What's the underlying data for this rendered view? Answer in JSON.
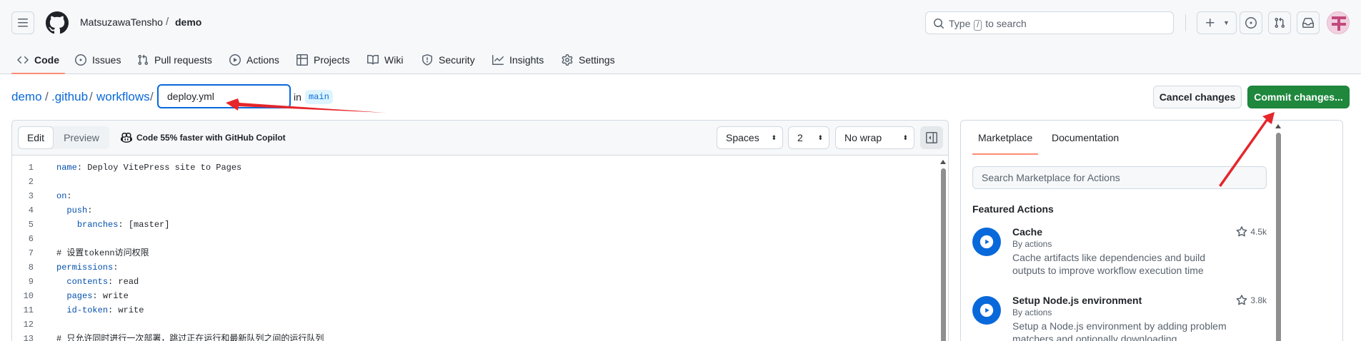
{
  "topbar": {
    "owner": "MatsuzawaTensho",
    "separator": "/",
    "repo": "demo",
    "search_prefix": "Type",
    "search_key": "/",
    "search_suffix": "to search"
  },
  "tabs": [
    {
      "label": "Code",
      "icon": "code-icon"
    },
    {
      "label": "Issues",
      "icon": "issue-icon"
    },
    {
      "label": "Pull requests",
      "icon": "pull-request-icon"
    },
    {
      "label": "Actions",
      "icon": "play-icon"
    },
    {
      "label": "Projects",
      "icon": "table-icon"
    },
    {
      "label": "Wiki",
      "icon": "book-icon"
    },
    {
      "label": "Security",
      "icon": "shield-icon"
    },
    {
      "label": "Insights",
      "icon": "graph-icon"
    },
    {
      "label": "Settings",
      "icon": "gear-icon"
    }
  ],
  "path": {
    "parts": [
      "demo",
      ".github",
      "workflows"
    ],
    "sep": "/",
    "filename": "deploy.yml",
    "in_label": "in",
    "branch": "main",
    "cancel_label": "Cancel changes",
    "commit_label": "Commit changes..."
  },
  "editor": {
    "edit_label": "Edit",
    "preview_label": "Preview",
    "copilot_text": "Code 55% faster with GitHub Copilot",
    "indent_mode": "Spaces",
    "indent_size": "2",
    "wrap_mode": "No wrap",
    "lines": [
      {
        "n": "1",
        "text": "name: Deploy VitePress site to Pages"
      },
      {
        "n": "2",
        "text": ""
      },
      {
        "n": "3",
        "text": "on:"
      },
      {
        "n": "4",
        "text": "  push:"
      },
      {
        "n": "5",
        "text": "    branches: [master]"
      },
      {
        "n": "6",
        "text": ""
      },
      {
        "n": "7",
        "text": "# 设置tokenn访问权限"
      },
      {
        "n": "8",
        "text": "permissions:"
      },
      {
        "n": "9",
        "text": "  contents: read"
      },
      {
        "n": "10",
        "text": "  pages: write"
      },
      {
        "n": "11",
        "text": "  id-token: write"
      },
      {
        "n": "12",
        "text": ""
      },
      {
        "n": "13",
        "text": "# 只允许同时进行一次部署，跳过正在运行和最新队列之间的运行队列"
      }
    ]
  },
  "side": {
    "tab_marketplace": "Marketplace",
    "tab_documentation": "Documentation",
    "search_placeholder": "Search Marketplace for Actions",
    "featured_title": "Featured Actions",
    "actions": [
      {
        "name": "Cache",
        "by": "By actions",
        "stars": "4.5k",
        "desc": "Cache artifacts like dependencies and build outputs to improve workflow execution time"
      },
      {
        "name": "Setup Node.js environment",
        "by": "By actions",
        "stars": "3.8k",
        "desc": "Setup a Node.js environment by adding problem matchers and optionally downloading"
      }
    ]
  },
  "colors": {
    "accent": "#0969da",
    "commit_green": "#1f883d",
    "annotation_red": "#e5262b",
    "active_tab_underline": "#fd8c73"
  }
}
